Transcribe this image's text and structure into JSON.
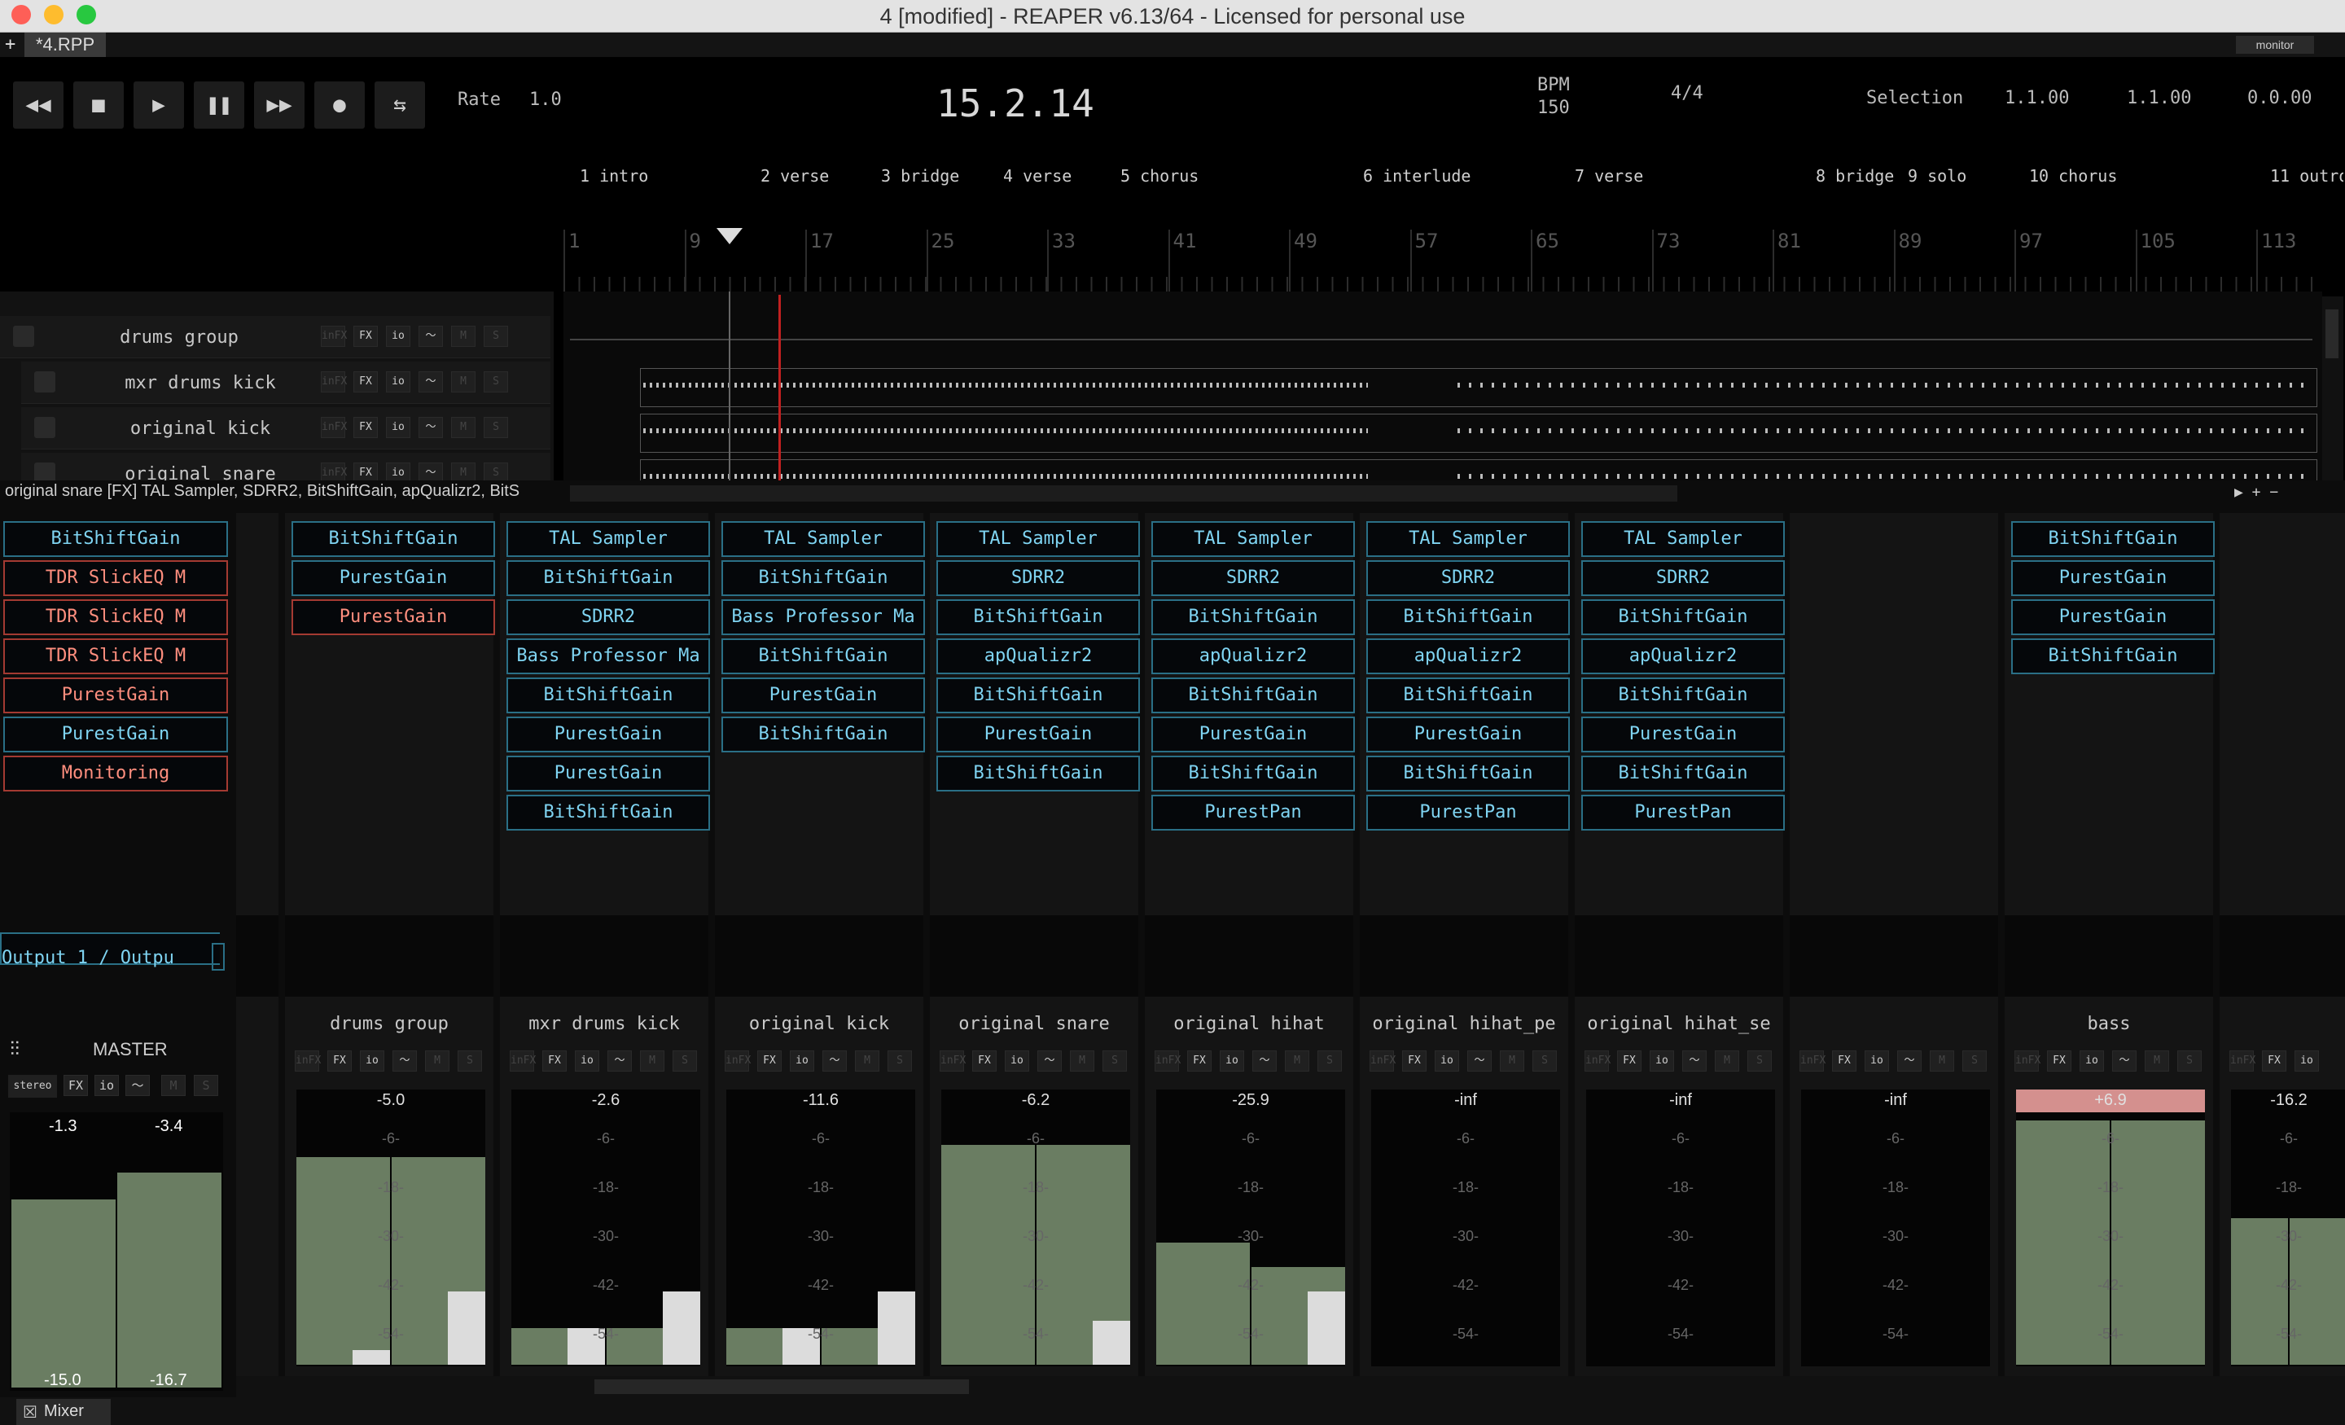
{
  "window": {
    "title": "4 [modified] - REAPER v6.13/64 - Licensed for personal use",
    "tab_plus": "+",
    "tab": "*4.RPP",
    "monitor": "monitor"
  },
  "transport": {
    "rewind": "◀◀",
    "stop": "■",
    "play": "▶",
    "pause": "❚❚",
    "ffwd": "▶▶",
    "record": "●",
    "loop": "⇆",
    "rate_label": "Rate",
    "rate": "1.0",
    "position": "15.2.14",
    "bpm_label": "BPM",
    "bpm": "150",
    "time_sig": "4/4",
    "selection_label": "Selection",
    "sel_start": "1.1.00",
    "sel_end": "1.1.00",
    "sel_len": "0.0.00"
  },
  "regions": [
    "1 intro",
    "2 verse",
    "3 bridge",
    "4 verse",
    "5 chorus",
    "6 interlude",
    "7 verse",
    "8 bridge",
    "9 solo",
    "10 chorus",
    "11 outro"
  ],
  "bars": [
    "1",
    "9",
    "17",
    "25",
    "33",
    "41",
    "49",
    "57",
    "65",
    "73",
    "81",
    "89",
    "97",
    "105",
    "113"
  ],
  "tracks": [
    "drums group",
    "mxr drums kick",
    "original kick",
    "original snare"
  ],
  "track_buttons": {
    "infx": "inFX",
    "fx": "FX",
    "io": "io",
    "env": "〜",
    "m": "M",
    "s": "S"
  },
  "status_line": "original snare [FX] TAL Sampler, SDRR2, BitShiftGain, apQualizr2, BitS",
  "fx_columns": [
    [
      {
        "n": "BitShiftGain",
        "c": "b"
      },
      {
        "n": "TDR SlickEQ M",
        "c": "r"
      },
      {
        "n": "TDR SlickEQ M",
        "c": "r"
      },
      {
        "n": "TDR SlickEQ M",
        "c": "r"
      },
      {
        "n": "PurestGain",
        "c": "r"
      },
      {
        "n": "PurestGain",
        "c": "b"
      },
      {
        "n": "Monitoring",
        "c": "r"
      }
    ],
    [
      {
        "n": "BitShiftGain",
        "c": "b"
      },
      {
        "n": "PurestGain",
        "c": "b"
      },
      {
        "n": "PurestGain",
        "c": "r"
      }
    ],
    [
      {
        "n": "TAL Sampler",
        "c": "b"
      },
      {
        "n": "BitShiftGain",
        "c": "b"
      },
      {
        "n": "SDRR2",
        "c": "b"
      },
      {
        "n": "Bass Professor Ma",
        "c": "b"
      },
      {
        "n": "BitShiftGain",
        "c": "b"
      },
      {
        "n": "PurestGain",
        "c": "b"
      },
      {
        "n": "PurestGain",
        "c": "b"
      },
      {
        "n": "BitShiftGain",
        "c": "b"
      }
    ],
    [
      {
        "n": "TAL Sampler",
        "c": "b"
      },
      {
        "n": "BitShiftGain",
        "c": "b"
      },
      {
        "n": "Bass Professor Ma",
        "c": "b"
      },
      {
        "n": "BitShiftGain",
        "c": "b"
      },
      {
        "n": "PurestGain",
        "c": "b"
      },
      {
        "n": "BitShiftGain",
        "c": "b"
      }
    ],
    [
      {
        "n": "TAL Sampler",
        "c": "b"
      },
      {
        "n": "SDRR2",
        "c": "b"
      },
      {
        "n": "BitShiftGain",
        "c": "b"
      },
      {
        "n": "apQualizr2",
        "c": "b"
      },
      {
        "n": "BitShiftGain",
        "c": "b"
      },
      {
        "n": "PurestGain",
        "c": "b"
      },
      {
        "n": "BitShiftGain",
        "c": "b"
      }
    ],
    [
      {
        "n": "TAL Sampler",
        "c": "b"
      },
      {
        "n": "SDRR2",
        "c": "b"
      },
      {
        "n": "BitShiftGain",
        "c": "b"
      },
      {
        "n": "apQualizr2",
        "c": "b"
      },
      {
        "n": "BitShiftGain",
        "c": "b"
      },
      {
        "n": "PurestGain",
        "c": "b"
      },
      {
        "n": "BitShiftGain",
        "c": "b"
      },
      {
        "n": "PurestPan",
        "c": "b"
      }
    ],
    [
      {
        "n": "TAL Sampler",
        "c": "b"
      },
      {
        "n": "SDRR2",
        "c": "b"
      },
      {
        "n": "BitShiftGain",
        "c": "b"
      },
      {
        "n": "apQualizr2",
        "c": "b"
      },
      {
        "n": "BitShiftGain",
        "c": "b"
      },
      {
        "n": "PurestGain",
        "c": "b"
      },
      {
        "n": "BitShiftGain",
        "c": "b"
      },
      {
        "n": "PurestPan",
        "c": "b"
      }
    ],
    [
      {
        "n": "TAL Sampler",
        "c": "b"
      },
      {
        "n": "SDRR2",
        "c": "b"
      },
      {
        "n": "BitShiftGain",
        "c": "b"
      },
      {
        "n": "apQualizr2",
        "c": "b"
      },
      {
        "n": "BitShiftGain",
        "c": "b"
      },
      {
        "n": "PurestGain",
        "c": "b"
      },
      {
        "n": "BitShiftGain",
        "c": "b"
      },
      {
        "n": "PurestPan",
        "c": "b"
      }
    ],
    [],
    [
      {
        "n": "BitShiftGain",
        "c": "b"
      },
      {
        "n": "PurestGain",
        "c": "b"
      },
      {
        "n": "PurestGain",
        "c": "b"
      },
      {
        "n": "BitShiftGain",
        "c": "b"
      }
    ]
  ],
  "master": {
    "name": "MASTER",
    "output": "Output 1 / Outpu",
    "stereo": "stereo",
    "peak_l": "-1.3",
    "peak_r": "-3.4",
    "rms_l": "-15.0",
    "rms_r": "-16.7",
    "level": [
      0.7,
      0.8
    ]
  },
  "channels": [
    {
      "name": "drums group",
      "val": "-5.0",
      "level": [
        0.85,
        0.85
      ],
      "peak": [
        0.1,
        0.5
      ]
    },
    {
      "name": "mxr drums kick",
      "val": "-2.6",
      "level": [
        0.15,
        0.15
      ],
      "peak": [
        0.25,
        0.5
      ]
    },
    {
      "name": "original kick",
      "val": "-11.6",
      "level": [
        0.15,
        0.15
      ],
      "peak": [
        0.25,
        0.5
      ]
    },
    {
      "name": "original snare",
      "val": "-6.2",
      "level": [
        0.9,
        0.9
      ],
      "peak": [
        0.0,
        0.3
      ]
    },
    {
      "name": "original hihat",
      "val": "-25.9",
      "level": [
        0.5,
        0.4
      ],
      "peak": [
        0.0,
        0.5
      ]
    },
    {
      "name": "original hihat_pe",
      "val": "-inf",
      "level": [
        0,
        0
      ],
      "peak": [
        0,
        0
      ]
    },
    {
      "name": "original hihat_se",
      "val": "-inf",
      "level": [
        0,
        0
      ],
      "peak": [
        0,
        0
      ]
    },
    {
      "name": "",
      "val": "-inf",
      "level": [
        0,
        0
      ],
      "peak": [
        0,
        0
      ]
    },
    {
      "name": "bass",
      "val": "+6.9",
      "level": [
        1,
        1
      ],
      "peak": [
        0,
        0
      ],
      "clip": true
    },
    {
      "name": "",
      "val": "-16.2",
      "level": [
        0.6,
        0.6
      ],
      "peak": [
        0,
        0
      ]
    }
  ],
  "meter_ticks": [
    "-6-",
    "-18-",
    "-30-",
    "-42-",
    "-54-"
  ],
  "mixer_tab": "Mixer"
}
